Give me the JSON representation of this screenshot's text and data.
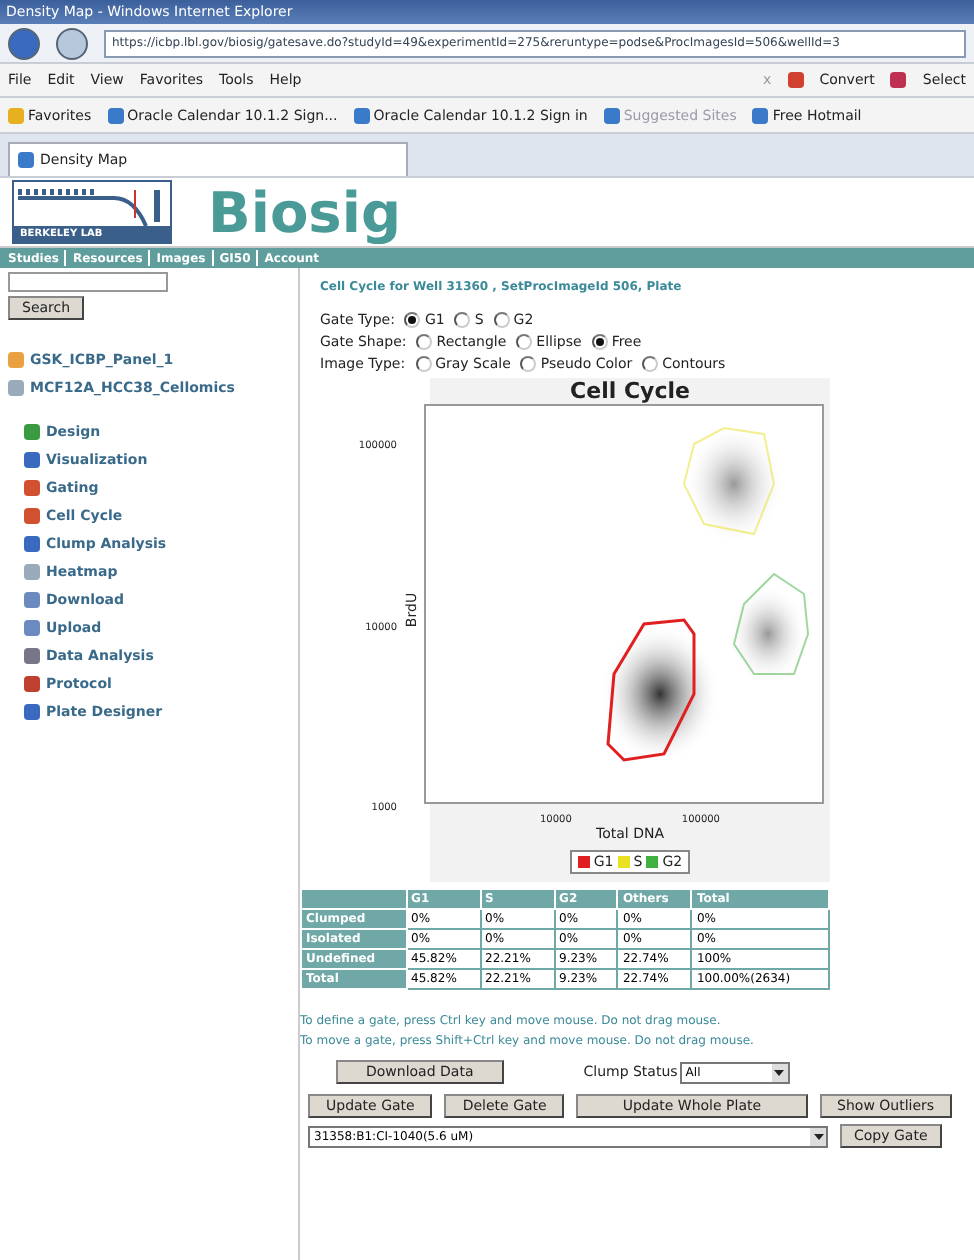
{
  "window": {
    "title": "Density Map - Windows Internet Explorer"
  },
  "address_bar": {
    "url": "https://icbp.lbl.gov/biosig/gatesave.do?studyId=49&experimentId=275&reruntype=podse&ProcImagesId=506&wellId=3"
  },
  "menu": [
    "File",
    "Edit",
    "View",
    "Favorites",
    "Tools",
    "Help"
  ],
  "toolbar": [
    {
      "kind": "close",
      "label": "x"
    },
    {
      "kind": "convert",
      "label": "Convert"
    },
    {
      "kind": "select",
      "label": "Select"
    }
  ],
  "favorites_bar": [
    {
      "label": "Favorites"
    },
    {
      "label": "Oracle Calendar 10.1.2 Sign..."
    },
    {
      "label": "Oracle Calendar 10.1.2 Sign in"
    },
    {
      "label": "Suggested Sites"
    },
    {
      "label": "Free Hotmail"
    }
  ],
  "browser_tab": {
    "label": "Density Map"
  },
  "header": {
    "logo_text": "BERKELEY LAB",
    "title": "Biosig"
  },
  "nav": [
    "Studies",
    "Resources",
    "Images",
    "GI50",
    "Account"
  ],
  "sidebar": {
    "search_button": "Search",
    "tree": [
      {
        "label": "GSK_ICBP_Panel_1"
      },
      {
        "label": "MCF12A_HCC38_Cellomics"
      }
    ],
    "items": [
      "Design",
      "Visualization",
      "Gating",
      "Cell Cycle",
      "Clump Analysis",
      "Heatmap",
      "Download",
      "Upload",
      "Data Analysis",
      "Protocol",
      "Plate Designer"
    ]
  },
  "content": {
    "subtitle": "Cell Cycle for Well 31360 , SetProcImageId 506, Plate",
    "options": [
      {
        "label": "Gate Type:",
        "choices": [
          {
            "label": "G1",
            "selected": true
          },
          {
            "label": "S",
            "selected": false
          },
          {
            "label": "G2",
            "selected": false
          }
        ]
      },
      {
        "label": "Gate Shape:",
        "choices": [
          {
            "label": "Rectangle",
            "selected": false
          },
          {
            "label": "Ellipse",
            "selected": false
          },
          {
            "label": "Free",
            "selected": true
          }
        ]
      },
      {
        "label": "Image Type:",
        "choices": [
          {
            "label": "Gray Scale",
            "selected": false
          },
          {
            "label": "Pseudo Color",
            "selected": false
          },
          {
            "label": "Contours",
            "selected": false
          }
        ]
      }
    ],
    "plot": {
      "title": "Cell Cycle",
      "ylabel": "BrdU",
      "xlabel": "Total DNA",
      "yticks": [
        "100000",
        "10000",
        "1000"
      ],
      "xticks": [
        "10000",
        "100000"
      ]
    },
    "legend": [
      {
        "label": "G1",
        "color": "#e02020"
      },
      {
        "label": "S",
        "color": "#e8e020"
      },
      {
        "label": "G2",
        "color": "#40b040"
      }
    ],
    "table": {
      "columns": [
        "",
        "G1",
        "S",
        "G2",
        "Others",
        "Total"
      ],
      "rows": [
        [
          "Clumped",
          "0%",
          "0%",
          "0%",
          "0%",
          "0%"
        ],
        [
          "Isolated",
          "0%",
          "0%",
          "0%",
          "0%",
          "0%"
        ],
        [
          "Undefined",
          "45.82%",
          "22.21%",
          "9.23%",
          "22.74%",
          "100%"
        ],
        [
          "Total",
          "45.82%",
          "22.21%",
          "9.23%",
          "22.74%",
          "100.00%(2634)"
        ]
      ]
    },
    "instructions": [
      "To define a gate, press Ctrl key and move mouse. Do not drag mouse.",
      "To move a gate, press Shift+Ctrl key and move mouse. Do not drag mouse."
    ],
    "download_button": "Download Data",
    "clump_status": {
      "label": "Clump Status",
      "value": "All"
    },
    "buttons": [
      "Update Gate",
      "Delete Gate",
      "Update Whole Plate",
      "Show Outliers"
    ],
    "well_select": {
      "value": "31358:B1:CI-1040(5.6 uM)"
    },
    "copy_button": "Copy Gate"
  }
}
